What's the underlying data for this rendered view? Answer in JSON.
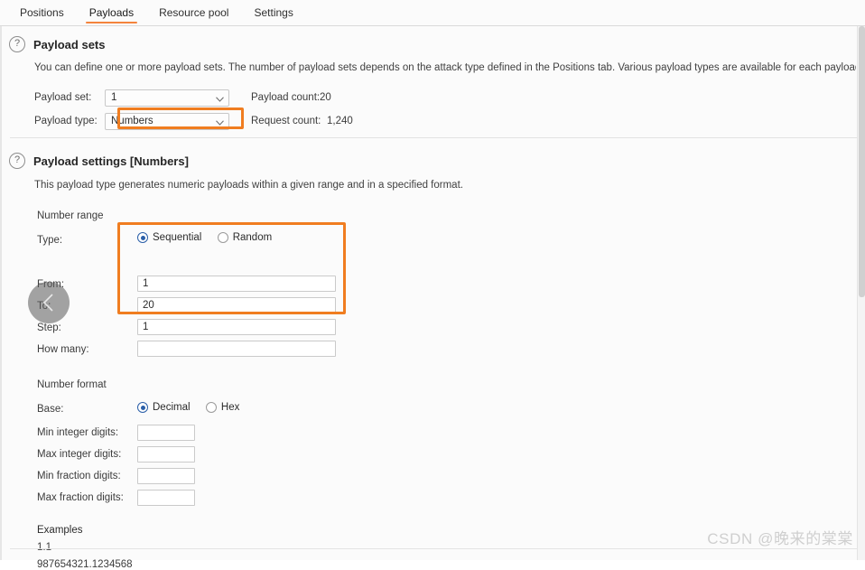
{
  "tabs": [
    {
      "label": "Positions",
      "active": false
    },
    {
      "label": "Payloads",
      "active": true
    },
    {
      "label": "Resource pool",
      "active": false
    },
    {
      "label": "Settings",
      "active": false
    }
  ],
  "payload_sets": {
    "help_icon": "question-mark-icon",
    "title": "Payload sets",
    "description": "You can define one or more payload sets. The number of payload sets depends on the attack type defined in the Positions tab. Various payload types are available for each payload set.",
    "payload_set_label": "Payload set:",
    "payload_set_value": "1",
    "payload_type_label": "Payload type:",
    "payload_type_value": "Numbers",
    "payload_count_label": "Payload count:",
    "payload_count_value": "20",
    "request_count_label": "Request count:",
    "request_count_value": "1,240"
  },
  "payload_settings": {
    "help_icon": "question-mark-icon",
    "title": "Payload settings [Numbers]",
    "description": "This payload type generates numeric payloads within a given range and in a specified format.",
    "number_range": {
      "group_label": "Number range",
      "type_label": "Type:",
      "type_options": [
        {
          "label": "Sequential",
          "selected": true
        },
        {
          "label": "Random",
          "selected": false
        }
      ],
      "from_label": "From:",
      "from_value": "1",
      "to_label": "To:",
      "to_value": "20",
      "step_label": "Step:",
      "step_value": "1",
      "how_many_label": "How many:",
      "how_many_value": ""
    },
    "number_format": {
      "group_label": "Number format",
      "base_label": "Base:",
      "base_options": [
        {
          "label": "Decimal",
          "selected": true
        },
        {
          "label": "Hex",
          "selected": false
        }
      ],
      "min_integer_digits_label": "Min integer digits:",
      "min_integer_digits_value": "",
      "max_integer_digits_label": "Max integer digits:",
      "max_integer_digits_value": "",
      "min_fraction_digits_label": "Min fraction digits:",
      "min_fraction_digits_value": "",
      "max_fraction_digits_label": "Max fraction digits:",
      "max_fraction_digits_value": ""
    },
    "examples": {
      "heading": "Examples",
      "lines": [
        "1.1",
        "987654321.1234568"
      ]
    }
  },
  "overlay": {
    "back_icon": "chevron-left-icon"
  },
  "watermark": "CSDN @晚来的棠棠",
  "colors": {
    "accent_orange": "#f07d20",
    "tab_underline": "#f4843c",
    "radio_blue": "#2b5fa8",
    "panel_bg": "#fbfbfb"
  }
}
